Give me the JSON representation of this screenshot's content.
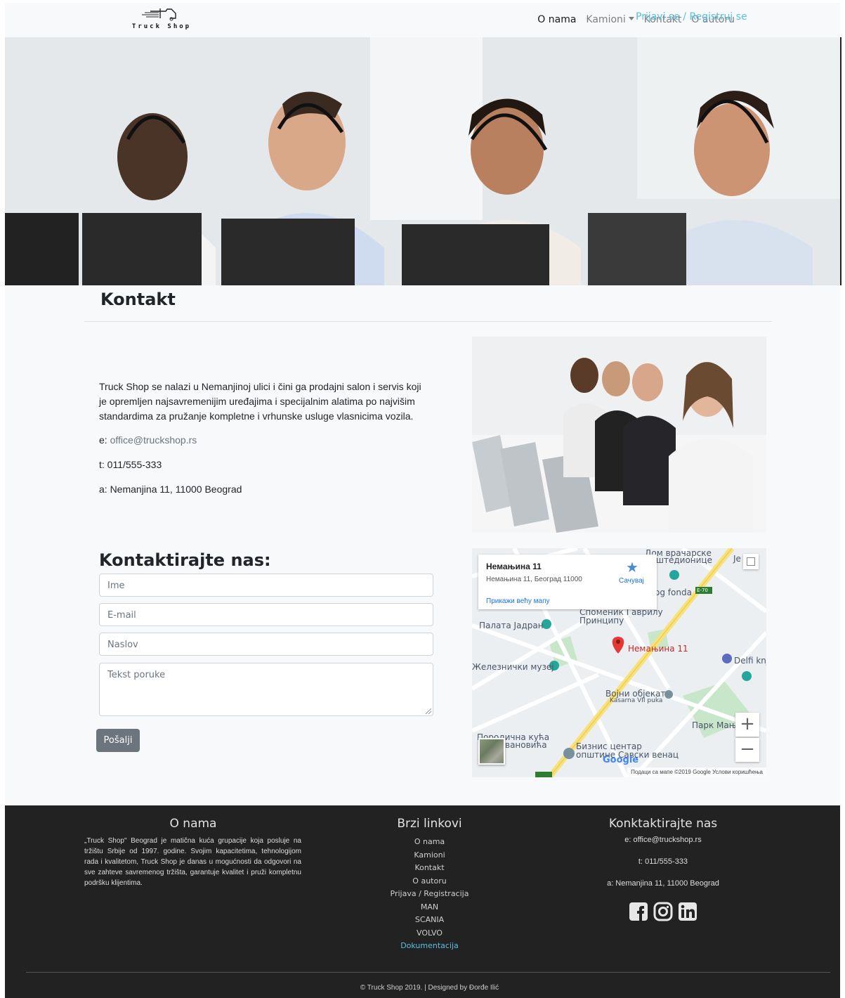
{
  "navbar": {
    "logo_text": "Truck Shop",
    "links": [
      {
        "label": "O nama",
        "active": true
      },
      {
        "label": "Kamioni",
        "dropdown": true
      },
      {
        "label": "Kontakt"
      },
      {
        "label": "O autoru"
      }
    ],
    "login_label": "Prijavi se / Registruj se"
  },
  "main": {
    "title": "Kontakt",
    "about": "Truck Shop se nalazi u Nemanjinoj ulici i čini ga prodajni salon i servis koji je opremljen najsavremenijim uređajima i specijalnim alatima po najvišim standardima za pružanje kompletne i vrhunske usluge vlasnicima vozila.",
    "email_prefix": "e: ",
    "email": "office@truckshop.rs",
    "phone": "t: 011/555-333",
    "address": "a: Nemanjina 11, 11000 Beograd"
  },
  "form": {
    "title": "Kontaktirajte nas:",
    "name_placeholder": "Ime",
    "email_placeholder": "E-mail",
    "subject_placeholder": "Naslov",
    "message_placeholder": "Tekst poruke",
    "submit_label": "Pošalji"
  },
  "map": {
    "place_name": "Немањина 11",
    "place_address": "Немањина 11, Београд 11000",
    "save_label": "Сачувај",
    "larger_map_label": "Прикажи већу мапу",
    "marker_label": "Немањина 11",
    "labels": {
      "dom": "Дом врачарске",
      "stedionice": "штедионице",
      "je": "Je",
      "fonda": "og fonda",
      "spomenik": "Споменик Гаврилу",
      "principu": "Принципу",
      "palata": "Палата Јадран",
      "muzej": "Железнички музеј",
      "delfi": "Delfi knji",
      "objekat": "Војни објекат",
      "kasarna": "Kasarna VII puka",
      "park": "Парк Мање",
      "kuca": "Породична кућа",
      "vanovica": "вановића",
      "biznis": "Бизнис центар",
      "opstine": "општине Савски венац",
      "e70": "E-70",
      "google": "Google"
    },
    "zoom_in": "+",
    "zoom_out": "−",
    "attribution": "Подаци са мапе ©2019 Google   Услови коришћења"
  },
  "footer": {
    "about_title": "O nama",
    "about_text": "„Truck Shop\" Beograd je matična kuća grupacije koja posluje na tržištu Srbije od 1997. godine. Svojim kapacitetima, tehnologijom rada i kvalitetom, Truck Shop je danas u mogućnosti da odgovori na sve zahteve savremenog tržišta, garantuje kvalitet i pruži kompletnu podršku klijentima.",
    "links_title": "Brzi linkovi",
    "links": [
      "O nama",
      "Kamioni",
      "Kontakt",
      "O autoru",
      "Prijava / Registracija",
      "MAN",
      "SCANIA",
      "VOLVO",
      "Dokumentacija"
    ],
    "contact_title": "Konktaktirajte nas",
    "contact_email": "e: office@truckshop.rs",
    "contact_phone": "t: 011/555-333",
    "contact_address": "a: Nemanjina 11, 11000 Beograd",
    "social_icons": [
      "facebook-icon",
      "instagram-icon",
      "linkedin-icon"
    ],
    "copyright": "© Truck Shop 2019. | Designed by Đorđe Ilić"
  },
  "colors": {
    "accent": "#5bc0de",
    "button": "#6c757d",
    "footer_bg": "#222222",
    "page_bg": "#f8f9fa"
  }
}
